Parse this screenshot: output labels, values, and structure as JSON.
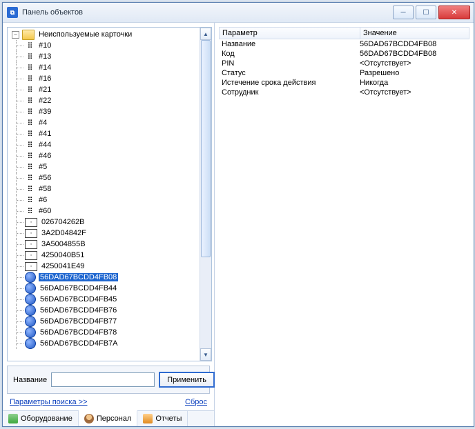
{
  "window": {
    "title": "Панель объектов"
  },
  "tree": {
    "root_label": "Неиспользуемые карточки",
    "items": [
      {
        "icon": "braille",
        "label": "#10"
      },
      {
        "icon": "braille",
        "label": "#13"
      },
      {
        "icon": "braille",
        "label": "#14"
      },
      {
        "icon": "braille",
        "label": "#16"
      },
      {
        "icon": "braille",
        "label": "#21"
      },
      {
        "icon": "braille",
        "label": "#22"
      },
      {
        "icon": "braille",
        "label": "#39"
      },
      {
        "icon": "braille",
        "label": "#4"
      },
      {
        "icon": "braille",
        "label": "#41"
      },
      {
        "icon": "braille",
        "label": "#44"
      },
      {
        "icon": "braille",
        "label": "#46"
      },
      {
        "icon": "braille",
        "label": "#5"
      },
      {
        "icon": "braille",
        "label": "#56"
      },
      {
        "icon": "braille",
        "label": "#58"
      },
      {
        "icon": "braille",
        "label": "#6"
      },
      {
        "icon": "braille",
        "label": "#60"
      },
      {
        "icon": "rect",
        "label": "026704262B"
      },
      {
        "icon": "rect",
        "label": "3A2D04842F"
      },
      {
        "icon": "rect",
        "label": "3A5004855B"
      },
      {
        "icon": "rect",
        "label": "4250040B51"
      },
      {
        "icon": "rect",
        "label": "4250041E49"
      },
      {
        "icon": "key",
        "label": "56DAD67BCDD4FB08",
        "selected": true
      },
      {
        "icon": "key",
        "label": "56DAD67BCDD4FB44"
      },
      {
        "icon": "key",
        "label": "56DAD67BCDD4FB45"
      },
      {
        "icon": "key",
        "label": "56DAD67BCDD4FB76"
      },
      {
        "icon": "key",
        "label": "56DAD67BCDD4FB77"
      },
      {
        "icon": "key",
        "label": "56DAD67BCDD4FB78"
      },
      {
        "icon": "key",
        "label": "56DAD67BCDD4FB7A"
      }
    ]
  },
  "search": {
    "label": "Название",
    "value": "",
    "apply": "Применить",
    "params_link": "Параметры поиска >>",
    "reset_link": "Сброс"
  },
  "tabs": {
    "equipment": "Оборудование",
    "personnel": "Персонал",
    "reports": "Отчеты"
  },
  "grid": {
    "header_param": "Параметр",
    "header_value": "Значение",
    "rows": [
      {
        "param": "Название",
        "value": "56DAD67BCDD4FB08"
      },
      {
        "param": "Код",
        "value": "56DAD67BCDD4FB08"
      },
      {
        "param": "PIN",
        "value": "<Отсутствует>"
      },
      {
        "param": "Статус",
        "value": "Разрешено"
      },
      {
        "param": "Истечение срока действия",
        "value": "Никогда"
      },
      {
        "param": "Сотрудник",
        "value": "<Отсутствует>"
      }
    ]
  }
}
